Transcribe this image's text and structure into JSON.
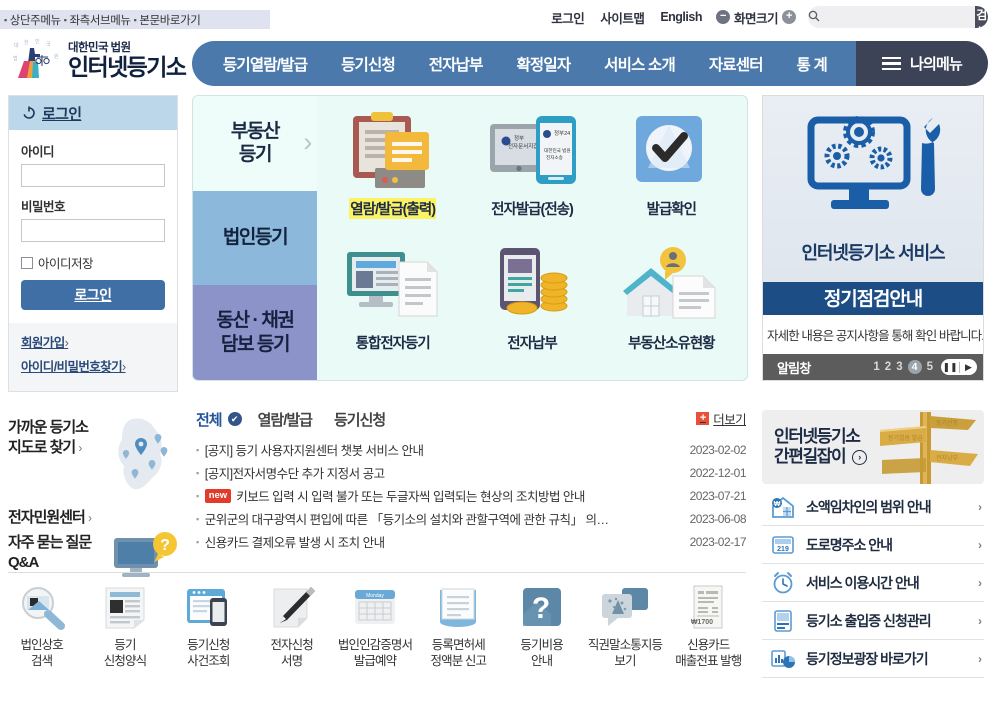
{
  "skip_links": [
    "상단주메뉴",
    "좌측서브메뉴",
    "본문바로가기"
  ],
  "utility": {
    "login": "로그인",
    "sitemap": "사이트맵",
    "english": "English",
    "zoom_label": "화면크기",
    "zoom_out": "−",
    "zoom_in": "+",
    "search_placeholder": "",
    "search_value": "",
    "search_button": "검색"
  },
  "logo": {
    "small": "대한민국 법원",
    "large": "인터넷등기소"
  },
  "main_nav": {
    "items": [
      "등기열람/발급",
      "등기신청",
      "전자납부",
      "확정일자",
      "서비스 소개",
      "자료센터",
      "통 계"
    ],
    "my_menu": "나의메뉴"
  },
  "login_panel": {
    "title": "로그인",
    "id_label": "아이디",
    "id_value": "",
    "pw_label": "비밀번호",
    "pw_value": "",
    "save_id": "아이디저장",
    "submit": "로그인",
    "join": "회원가입",
    "find": "아이디/비밀번호찾기",
    "arrow": "›"
  },
  "left_links": {
    "find_office_line1": "가까운 등기소",
    "find_office_line2": "지도로 찾기",
    "e_center": "전자민원센터",
    "faq_line1": "자주 묻는 질문",
    "faq_line2": "Q&A",
    "arrow": "›"
  },
  "hero": {
    "tabs": [
      {
        "label": "부동산\n등기",
        "state": "active"
      },
      {
        "label": "법인등기",
        "state": "t2"
      },
      {
        "label": "동산 · 채권\n담보 등기",
        "state": "t3"
      }
    ],
    "cells": [
      {
        "name": "열람/발급(출력)",
        "icon": "clipboard-documents-icon",
        "highlight": true
      },
      {
        "name": "전자발급(전송)",
        "icon": "tablet-phone-icon",
        "highlight": false
      },
      {
        "name": "발급확인",
        "icon": "check-badge-icon",
        "highlight": false
      },
      {
        "name": "통합전자등기",
        "icon": "monitor-document-icon",
        "highlight": false
      },
      {
        "name": "전자납부",
        "icon": "phone-coins-icon",
        "highlight": false
      },
      {
        "name": "부동산소유현황",
        "icon": "house-document-icon",
        "highlight": false
      }
    ]
  },
  "right_banner": {
    "title1": "인터넷등기소 서비스",
    "title2": "정기점검안내",
    "desc": "자세한 내용은 공지사항을 통해 확인 바랍니다.",
    "foot_label": "알림창",
    "pages": [
      "1",
      "2",
      "3",
      "4",
      "5"
    ],
    "active_page": "4",
    "pause": "❚❚",
    "next": "▶"
  },
  "board": {
    "tabs": [
      {
        "label": "전체",
        "active": true
      },
      {
        "label": "열람/발급",
        "active": false
      },
      {
        "label": "등기신청",
        "active": false
      }
    ],
    "check_icon": "✔",
    "more": "더보기",
    "more_plus": "+",
    "rows": [
      {
        "badge": "",
        "title": "[공지] 등기 사용자지원센터 챗봇 서비스 안내",
        "date": "2023-02-02"
      },
      {
        "badge": "",
        "title": "[공지]전자서명수단 추가 지정서 공고",
        "date": "2022-12-01"
      },
      {
        "badge": "new",
        "title": "키보드 입력 시 입력 불가 또는 두글자씩 입력되는 현상의 조치방법 안내",
        "date": "2023-07-21"
      },
      {
        "badge": "",
        "title": "군위군의 대구광역시 편입에 따른 「등기소의 설치와 관할구역에 관한 규칙」 의…",
        "date": "2023-06-08"
      },
      {
        "badge": "",
        "title": "신용카드 결제오류 발생 시 조치 안내",
        "date": "2023-02-17"
      }
    ]
  },
  "right_guide": {
    "banner_line1": "인터넷등기소",
    "banner_line2": "간편길잡이",
    "banner_arrow": "›",
    "items": [
      {
        "label": "소액임차인의 범위 안내",
        "icon": "house-won-icon",
        "arrow": "›"
      },
      {
        "label": "도로명주소 안내",
        "icon": "address-plate-icon",
        "arrow": "›"
      },
      {
        "label": "서비스 이용시간 안내",
        "icon": "alarm-clock-icon",
        "arrow": "›"
      },
      {
        "label": "등기소 출입증 신청관리",
        "icon": "id-card-icon",
        "arrow": "›"
      },
      {
        "label": "등기정보광장 바로가기",
        "icon": "chart-pie-icon",
        "arrow": "›"
      }
    ]
  },
  "quick_links": [
    {
      "label": "법인상호\n검색",
      "icon": "magnifier-search-icon"
    },
    {
      "label": "등기\n신청양식",
      "icon": "form-document-icon"
    },
    {
      "label": "등기신청\n사건조회",
      "icon": "browser-mobile-icon"
    },
    {
      "label": "전자신청\n서명",
      "icon": "pen-signature-icon"
    },
    {
      "label": "법인인감증명서\n발급예약",
      "icon": "calendar-icon"
    },
    {
      "label": "등록면허세\n정액분 신고",
      "icon": "book-icon"
    },
    {
      "label": "등기비용\n안내",
      "icon": "question-mark-icon"
    },
    {
      "label": "직권말소통지등\n보기",
      "icon": "speech-bubbles-icon"
    },
    {
      "label": "신용카드\n매출전표 발행",
      "icon": "receipt-icon"
    }
  ],
  "colors": {
    "nav_blue": "#4b79ab",
    "mymenu_dark": "#3d4356",
    "hero_bg": "#eafaf7",
    "tab2": "#8cb8db",
    "tab3": "#8b93c9",
    "banner_dark_blue": "#1c4e85",
    "accent_red": "#e03b2b",
    "highlight_yellow": "#fbf264",
    "login_btn": "#3f6fa5",
    "login_head": "#bcd6ea"
  }
}
